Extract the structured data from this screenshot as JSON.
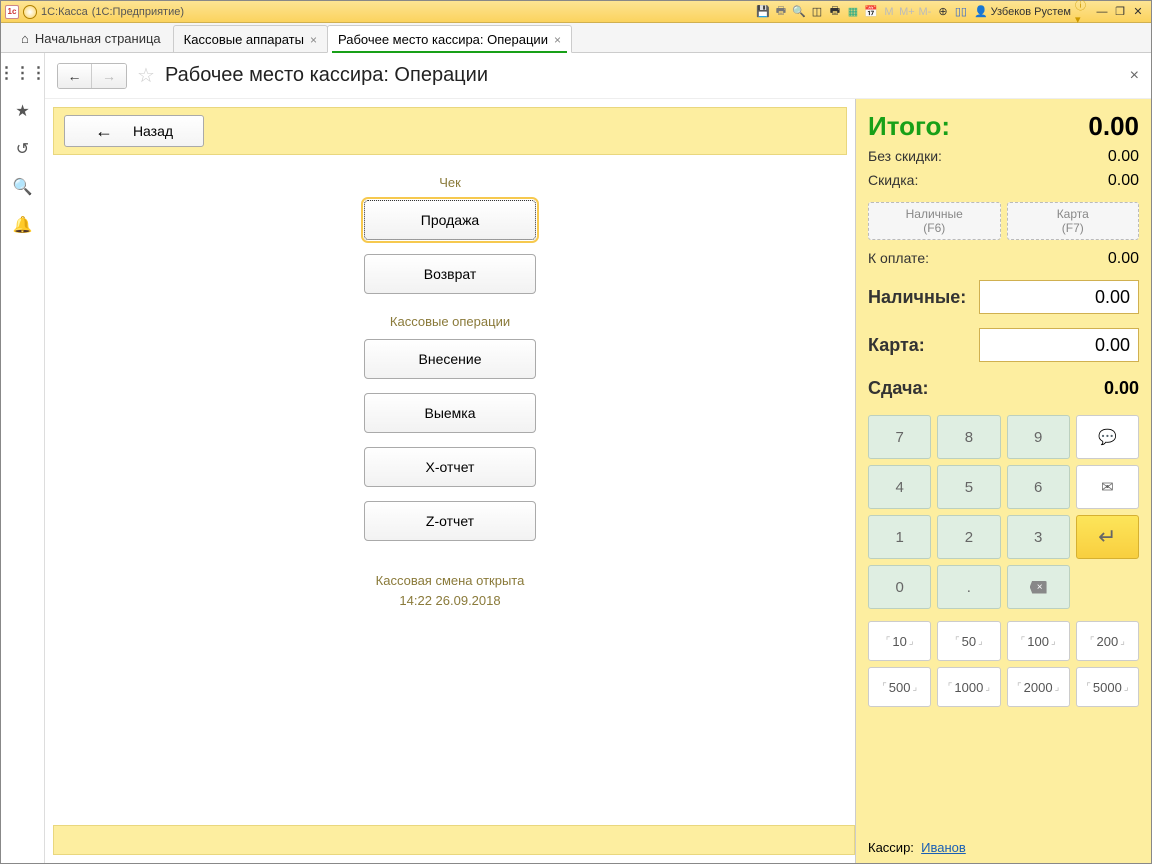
{
  "titlebar": {
    "app": "1С:Касса",
    "mode": "(1С:Предприятие)",
    "user": "Узбеков Рустем"
  },
  "tabs": {
    "home": "Начальная страница",
    "t1": "Кассовые аппараты",
    "t2": "Рабочее место кассира: Операции"
  },
  "page": {
    "title": "Рабочее место кассира: Операции",
    "back": "Назад"
  },
  "sections": {
    "check": {
      "title": "Чек",
      "sale": "Продажа",
      "return": "Возврат"
    },
    "cashops": {
      "title": "Кассовые операции",
      "deposit": "Внесение",
      "withdraw": "Выемка",
      "xrep": "X-отчет",
      "zrep": "Z-отчет"
    },
    "shift": {
      "line1": "Кассовая смена открыта",
      "line2": "14:22 26.09.2018"
    }
  },
  "totals": {
    "itogo_lbl": "Итого:",
    "itogo_val": "0.00",
    "nodisc_lbl": "Без скидки:",
    "nodisc_val": "0.00",
    "disc_lbl": "Скидка:",
    "disc_val": "0.00",
    "cash_btn": "Наличные",
    "cash_hint": "(F6)",
    "card_btn": "Карта",
    "card_hint": "(F7)",
    "topay_lbl": "К оплате:",
    "topay_val": "0.00",
    "cash_lbl": "Наличные:",
    "cash_val": "0.00",
    "card_lbl": "Карта:",
    "card_val": "0.00",
    "change_lbl": "Сдача:",
    "change_val": "0.00"
  },
  "keypad": {
    "k7": "7",
    "k8": "8",
    "k9": "9",
    "k4": "4",
    "k5": "5",
    "k6": "6",
    "k1": "1",
    "k2": "2",
    "k3": "3",
    "k0": "0",
    "kdot": ".",
    "bsp": "×"
  },
  "denoms": {
    "d10": "10",
    "d50": "50",
    "d100": "100",
    "d200": "200",
    "d500": "500",
    "d1000": "1000",
    "d2000": "2000",
    "d5000": "5000"
  },
  "cashier": {
    "lbl": "Кассир:",
    "name": "Иванов"
  }
}
